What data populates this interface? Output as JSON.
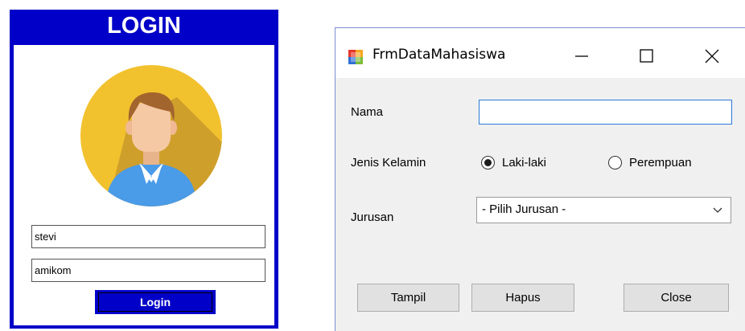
{
  "login": {
    "title": "LOGIN",
    "username_value": "stevi",
    "password_value": "amikom",
    "login_button_label": "Login",
    "colors": {
      "frame": "#0000c8",
      "avatar_bg": "#f2c12e",
      "avatar_shadow": "#c9992a",
      "shirt": "#4a9be8",
      "hair": "#a2652e",
      "skin": "#f5c9a4"
    }
  },
  "form": {
    "window_title": "FrmDataMahasiswa",
    "nama_label": "Nama",
    "nama_value": "",
    "gender_label": "Jenis Kelamin",
    "gender_options": [
      {
        "label": "Laki-laki",
        "checked": true
      },
      {
        "label": "Perempuan",
        "checked": false
      }
    ],
    "jurusan_label": "Jurusan",
    "jurusan_selected": "- Pilih Jurusan -",
    "buttons": {
      "tampil": "Tampil",
      "hapus": "Hapus",
      "close": "Close"
    },
    "icons": {
      "app": "form-icon",
      "minimize": "minimize-icon",
      "maximize": "maximize-icon",
      "close": "close-icon",
      "dropdown": "chevron-down-icon"
    }
  }
}
